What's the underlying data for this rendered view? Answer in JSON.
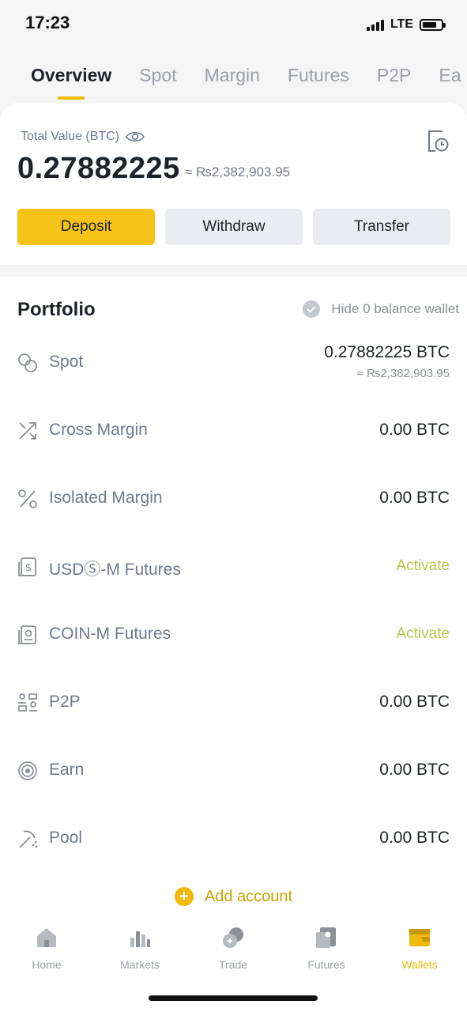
{
  "status_bar": {
    "time": "17:23",
    "network": "LTE"
  },
  "tabs": [
    {
      "label": "Overview",
      "active": true
    },
    {
      "label": "Spot",
      "active": false
    },
    {
      "label": "Margin",
      "active": false
    },
    {
      "label": "Futures",
      "active": false
    },
    {
      "label": "P2P",
      "active": false
    },
    {
      "label": "Ea",
      "active": false
    }
  ],
  "summary": {
    "total_label": "Total Value (BTC)",
    "total_btc": "0.27882225",
    "total_fiat": "≈ ₨2,382,903.95",
    "buttons": {
      "deposit": "Deposit",
      "withdraw": "Withdraw",
      "transfer": "Transfer"
    }
  },
  "portfolio": {
    "title": "Portfolio",
    "hide_zero_label": "Hide 0 balance wallet",
    "accounts": [
      {
        "icon": "spot-icon",
        "label": "Spot",
        "value": "0.27882225 BTC",
        "sub": "≈ ₨2,382,903.95"
      },
      {
        "icon": "cross-margin-icon",
        "label": "Cross Margin",
        "value": "0.00 BTC"
      },
      {
        "icon": "isolated-margin-icon",
        "label": "Isolated Margin",
        "value": "0.00 BTC"
      },
      {
        "icon": "usds-futures-icon",
        "label": "USDⓈ-M Futures",
        "action": "Activate"
      },
      {
        "icon": "coin-futures-icon",
        "label": "COIN-M Futures",
        "action": "Activate"
      },
      {
        "icon": "p2p-icon",
        "label": "P2P",
        "value": "0.00 BTC"
      },
      {
        "icon": "earn-icon",
        "label": "Earn",
        "value": "0.00 BTC"
      },
      {
        "icon": "pool-icon",
        "label": "Pool",
        "value": "0.00 BTC"
      }
    ],
    "add_account": "Add account"
  },
  "bottom_nav": [
    {
      "label": "Home",
      "icon": "home-icon",
      "active": false
    },
    {
      "label": "Markets",
      "icon": "markets-icon",
      "active": false
    },
    {
      "label": "Trade",
      "icon": "trade-icon",
      "active": false
    },
    {
      "label": "Futures",
      "icon": "futures-icon",
      "active": false
    },
    {
      "label": "Wallets",
      "icon": "wallet-icon",
      "active": true
    }
  ],
  "colors": {
    "accent": "#f0b90b",
    "activate": "#b7c74a",
    "muted": "#707a8a"
  }
}
